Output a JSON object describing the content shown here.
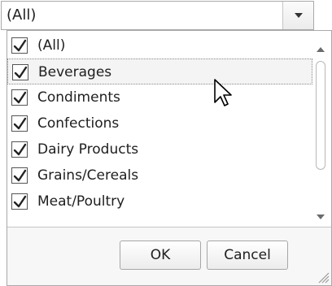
{
  "combo": {
    "value": "(All)"
  },
  "checklist": {
    "items": [
      {
        "label": "(All)",
        "checked": true
      },
      {
        "label": "Beverages",
        "checked": true,
        "hovered": true
      },
      {
        "label": "Condiments",
        "checked": true
      },
      {
        "label": "Confections",
        "checked": true
      },
      {
        "label": "Dairy Products",
        "checked": true
      },
      {
        "label": "Grains/Cereals",
        "checked": true
      },
      {
        "label": "Meat/Poultry",
        "checked": true
      }
    ]
  },
  "buttons": {
    "ok_label": "OK",
    "cancel_label": "Cancel"
  },
  "icons": {
    "dropdown": "chevron-down-icon",
    "checkbox": "checkmark-icon",
    "scroll_up": "scroll-up-arrow-icon",
    "scroll_down": "scroll-down-arrow-icon",
    "resize": "resize-grip-icon",
    "cursor": "mouse-pointer-icon"
  }
}
